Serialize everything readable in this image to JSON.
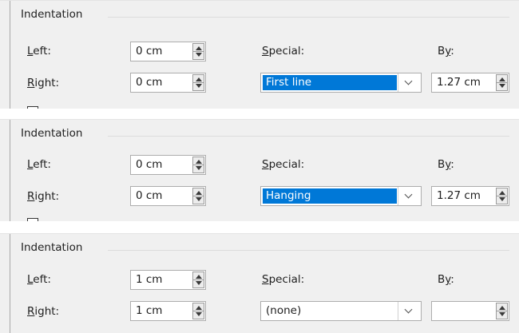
{
  "panels": [
    {
      "group_title": "Indentation",
      "left_label": "Left:",
      "left_accel": "L",
      "left_rest": "eft:",
      "left_value": "0 cm",
      "right_label": "Right:",
      "right_accel": "R",
      "right_rest": "ight:",
      "right_value": "0 cm",
      "special_label": "Special:",
      "special_accel": "S",
      "special_rest": "pecial:",
      "special_value": "First line",
      "special_highlighted": true,
      "by_label": "By:",
      "by_pre": "B",
      "by_accel": "y",
      "by_post": ":",
      "by_value": "1.27 cm"
    },
    {
      "group_title": "Indentation",
      "left_label": "Left:",
      "left_accel": "L",
      "left_rest": "eft:",
      "left_value": "0 cm",
      "right_label": "Right:",
      "right_accel": "R",
      "right_rest": "ight:",
      "right_value": "0 cm",
      "special_label": "Special:",
      "special_accel": "S",
      "special_rest": "pecial:",
      "special_value": "Hanging",
      "special_highlighted": true,
      "by_label": "By:",
      "by_pre": "B",
      "by_accel": "y",
      "by_post": ":",
      "by_value": "1.27 cm"
    },
    {
      "group_title": "Indentation",
      "left_label": "Left:",
      "left_accel": "L",
      "left_rest": "eft:",
      "left_value": "1 cm",
      "right_label": "Right:",
      "right_accel": "R",
      "right_rest": "ight:",
      "right_value": "1 cm",
      "special_label": "Special:",
      "special_accel": "S",
      "special_rest": "pecial:",
      "special_value": "(none)",
      "special_highlighted": false,
      "by_label": "By:",
      "by_pre": "B",
      "by_accel": "y",
      "by_post": ":",
      "by_value": ""
    }
  ],
  "colors": {
    "panel_bg": "#f0f0f0",
    "selection": "#0078d7",
    "selection_text": "#ffffff"
  },
  "icons": {
    "spin_arrows": "spin-up-down-icon",
    "dropdown": "chevron-down-icon"
  }
}
